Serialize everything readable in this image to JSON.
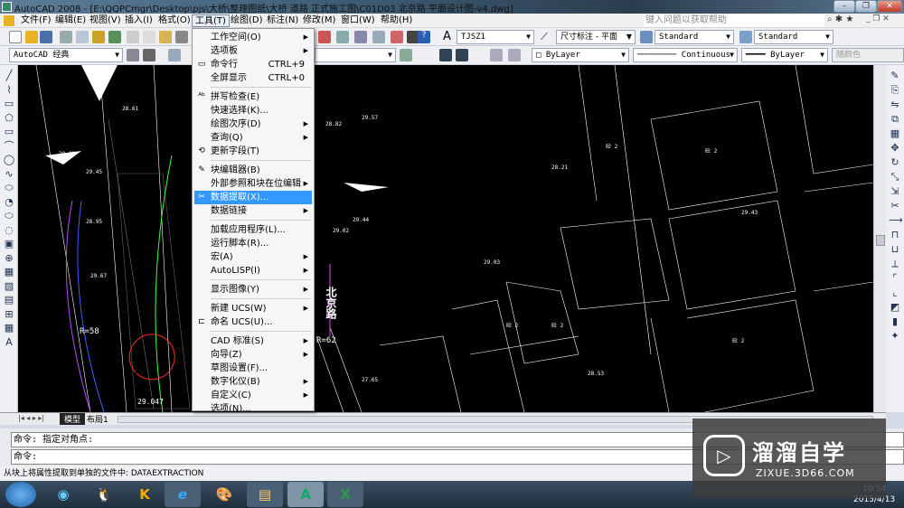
{
  "window": {
    "title": "AutoCAD 2008 - [E:\\QQPCmgr\\Desktop\\pjs\\大桥\\整理图纸\\大桥 道路 正式施工图\\C01D03 北京路 平面设计图-v4.dwg]",
    "min": "–",
    "max": "❐",
    "close": "✕"
  },
  "menubar": {
    "items": [
      "文件(F)",
      "编辑(E)",
      "视图(V)",
      "插入(I)",
      "格式(O)",
      "工具(T)",
      "绘图(D)",
      "标注(N)",
      "修改(M)",
      "窗口(W)",
      "帮助(H)"
    ],
    "help_placeholder": "键入问题以获取帮助"
  },
  "toolbar": {
    "workspace": "AutoCAD 经典",
    "text_style": "TJSZ1",
    "dim_style": "尺寸标注 - 平面",
    "table_style": "Standard",
    "multileader_style": "Standard",
    "color": "ByLayer",
    "linetype": "Continuous",
    "lineweight": "ByLayer",
    "plotstyle": "随颜色"
  },
  "tools_menu": {
    "items": [
      {
        "label": "工作空间(O)",
        "sub": true
      },
      {
        "label": "选项板",
        "sub": true
      },
      {
        "label": "命令行",
        "shortcut": "CTRL+9",
        "icon": "▭"
      },
      {
        "label": "全屏显示",
        "shortcut": "CTRL+0"
      },
      {
        "label": "拼写检查(E)",
        "icon": "ᴬᵇ"
      },
      {
        "label": "快速选择(K)..."
      },
      {
        "label": "绘图次序(D)",
        "sub": true
      },
      {
        "label": "查询(Q)",
        "sub": true
      },
      {
        "label": "更新字段(T)",
        "icon": "⟲"
      },
      {
        "label": "块编辑器(B)",
        "icon": "✎"
      },
      {
        "label": "外部参照和块在位编辑",
        "sub": true
      },
      {
        "label": "数据提取(X)...",
        "icon": "✂",
        "selected": true
      },
      {
        "label": "数据链接",
        "sub": true
      },
      {
        "label": "加载应用程序(L)..."
      },
      {
        "label": "运行脚本(R)..."
      },
      {
        "label": "宏(A)",
        "sub": true
      },
      {
        "label": "AutoLISP(I)",
        "sub": true
      },
      {
        "label": "显示图像(Y)",
        "sub": true
      },
      {
        "label": "新建 UCS(W)",
        "sub": true
      },
      {
        "label": "命名 UCS(U)...",
        "icon": "⊏"
      },
      {
        "label": "CAD 标准(S)",
        "sub": true
      },
      {
        "label": "向导(Z)",
        "sub": true
      },
      {
        "label": "草图设置(F)..."
      },
      {
        "label": "数字化仪(B)",
        "sub": true
      },
      {
        "label": "自定义(C)",
        "sub": true
      },
      {
        "label": "选项(N)..."
      }
    ]
  },
  "tabs": {
    "model": "模型",
    "layout1": "布局1"
  },
  "command": {
    "line1": "命令: 指定对角点:",
    "line2": "命令:"
  },
  "status": {
    "text": "从块上将属性提取到单独的文件中:  DATAEXTRACTION"
  },
  "drawing_labels": [
    "29.45",
    "29.57",
    "28.61",
    "29.02",
    "29.44",
    "28.82",
    "29.03",
    "28.21",
    "28.95",
    "29.43",
    "28.53",
    "29.67",
    "27.65",
    "28.06",
    "29.047",
    "R=58",
    "R=62",
    "北京路",
    "砼 2",
    "砼 2",
    "砼 2",
    "砼 2",
    "砼 2"
  ],
  "watermark": {
    "brand": "溜溜自学",
    "url": "ZIXUE.3D66.COM"
  },
  "clock": {
    "time": "10:54",
    "date": "2015/4/13"
  }
}
